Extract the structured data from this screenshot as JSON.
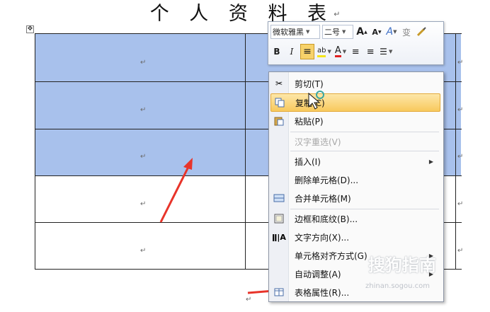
{
  "document": {
    "title": "个 人 资 料 表",
    "paragraph_mark": "↵",
    "move_handle": "✥"
  },
  "mini_toolbar": {
    "font_name": "微软雅黑",
    "font_size": "二号",
    "grow_font": "A",
    "shrink_font": "A",
    "style_a": "A",
    "format_painter_text": "变",
    "bold": "B",
    "italic": "I",
    "center_icon": "≡",
    "highlight_text": "ab",
    "font_color": "A",
    "indent_text": "≡",
    "outdent_text": "≡",
    "list_text": "☰"
  },
  "context_menu": {
    "items": [
      {
        "label": "剪切(T)",
        "icon": "scissors-icon"
      },
      {
        "label": "复制(C)",
        "icon": "copy-icon",
        "highlighted": true
      },
      {
        "label": "粘贴(P)",
        "icon": "paste-icon"
      },
      {
        "label": "汉字重选(V)",
        "disabled": true
      },
      {
        "label": "插入(I)",
        "submenu": true
      },
      {
        "label": "删除单元格(D)..."
      },
      {
        "label": "合并单元格(M)",
        "icon": "merge-cells-icon"
      },
      {
        "label": "边框和底纹(B)...",
        "icon": "borders-icon"
      },
      {
        "label": "文字方向(X)...",
        "icon": "text-direction-icon"
      },
      {
        "label": "单元格对齐方式(G)",
        "submenu": true
      },
      {
        "label": "自动调整(A)",
        "submenu": true
      },
      {
        "label": "表格属性(R)...",
        "icon": "table-properties-icon"
      }
    ],
    "submenu_arrow": "▶"
  },
  "watermark": {
    "text": "搜狗指南",
    "url": "zhinan.sogou.com"
  },
  "colors": {
    "selection": "#a8c1ec",
    "arrow": "#e8342a",
    "highlight": "#f8c95d"
  }
}
